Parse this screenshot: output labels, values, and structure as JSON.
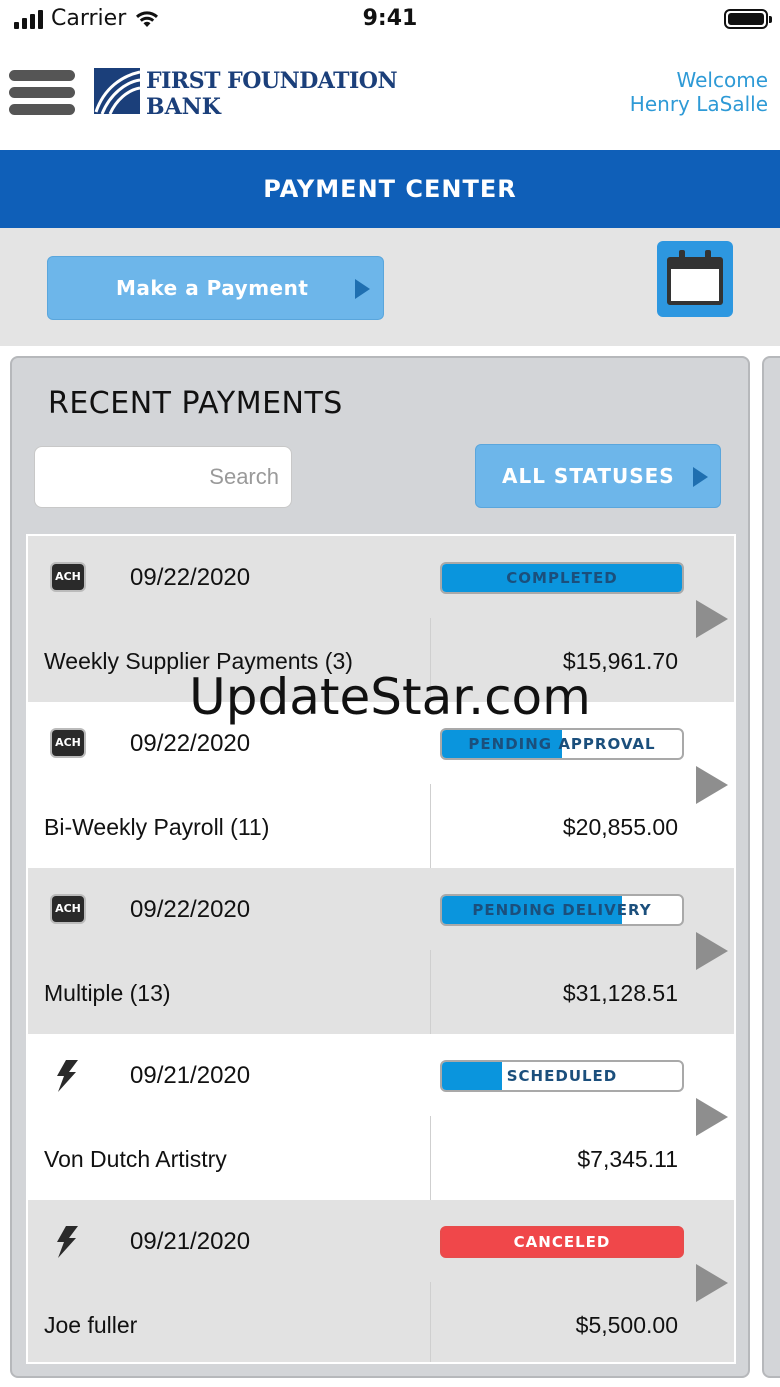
{
  "status_bar": {
    "carrier": "Carrier",
    "time": "9:41"
  },
  "header": {
    "logo_line1": "FIRST FOUNDATION",
    "logo_line2": "BANK",
    "welcome": "Welcome",
    "user_name": "Henry LaSalle"
  },
  "page_title": "PAYMENT CENTER",
  "actions": {
    "make_payment": "Make a Payment"
  },
  "recent": {
    "title": "RECENT PAYMENTS",
    "search_placeholder": "Search",
    "status_filter": "ALL STATUSES"
  },
  "payments": [
    {
      "type": "ACH",
      "icon": "ach-icon",
      "date": "09/22/2020",
      "name": "Weekly Supplier Payments (3)",
      "amount": "$15,961.70",
      "status": "COMPLETED",
      "progress": 1.0
    },
    {
      "type": "ACH",
      "icon": "ach-icon",
      "date": "09/22/2020",
      "name": "Bi-Weekly Payroll (11)",
      "amount": "$20,855.00",
      "status": "PENDING APPROVAL",
      "progress": 0.5
    },
    {
      "type": "ACH",
      "icon": "ach-icon",
      "date": "09/22/2020",
      "name": "Multiple (13)",
      "amount": "$31,128.51",
      "status": "PENDING DELIVERY",
      "progress": 0.75
    },
    {
      "type": "",
      "icon": "lightning-icon",
      "date": "09/21/2020",
      "name": "Von Dutch Artistry",
      "amount": "$7,345.11",
      "status": "SCHEDULED",
      "progress": 0.25
    },
    {
      "type": "",
      "icon": "lightning-icon",
      "date": "09/21/2020",
      "name": "Joe fuller",
      "amount": "$5,500.00",
      "status": "CANCELED",
      "progress": 1.0
    }
  ],
  "colors": {
    "brand_blue": "#0f5fb8",
    "button_blue": "#6db6ea",
    "progress_blue": "#0a95dd",
    "canceled_red": "#f0474a",
    "welcome_text": "#2e9ad6"
  },
  "watermark": "UpdateStar.com"
}
